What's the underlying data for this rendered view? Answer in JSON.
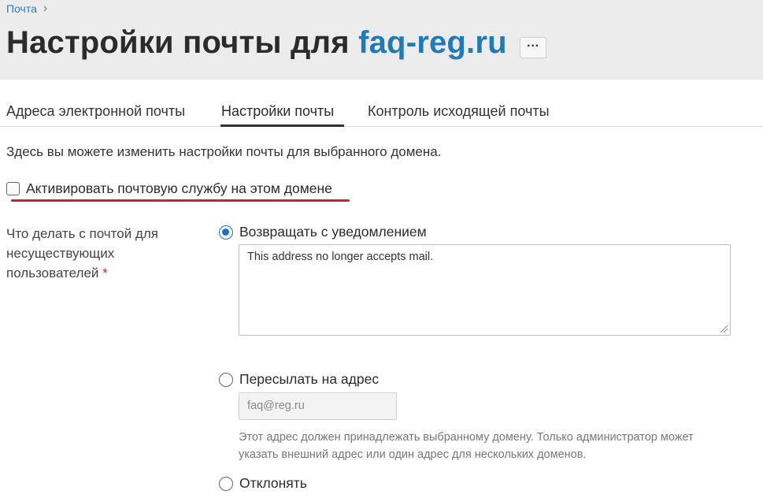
{
  "breadcrumb": {
    "link": "Почта",
    "separator": "›"
  },
  "header": {
    "title_prefix": "Настройки почты для ",
    "domain": "faq-reg.ru",
    "more_label": "···"
  },
  "tabs": [
    {
      "label": "Адреса электронной почты",
      "active": false
    },
    {
      "label": "Настройки почты",
      "active": true
    },
    {
      "label": "Контроль исходящей почты",
      "active": false
    }
  ],
  "intro": "Здесь вы можете изменить настройки почты для выбранного домена.",
  "activate": {
    "label": "Активировать почтовую службу на этом домене",
    "checked": false
  },
  "nonexistent_users": {
    "label": "Что делать с почтой для несуществующих пользователей",
    "required_mark": "*",
    "options": [
      {
        "label": "Возвращать с уведомлением",
        "checked": true
      },
      {
        "label": "Пересылать на адрес",
        "checked": false
      },
      {
        "label": "Отклонять",
        "checked": false
      }
    ],
    "bounce_message": "This address no longer accepts mail.",
    "forward_address": "faq@reg.ru",
    "forward_hint": "Этот адрес должен принадлежать выбранному домену. Только администратор может указать внешний адрес или один адрес для нескольких доменов."
  },
  "colors": {
    "accent": "#1f7ab6",
    "link": "#2f7fb3",
    "header_bg": "#ececec",
    "highlight_line": "#c62828",
    "radio_checked": "#1f6fbf"
  }
}
